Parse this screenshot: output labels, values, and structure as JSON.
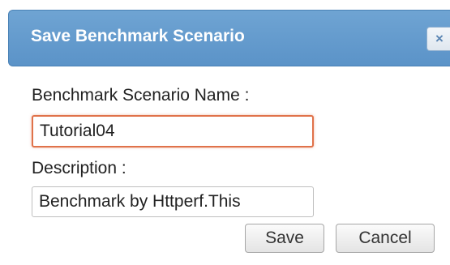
{
  "dialog": {
    "title": "Save Benchmark Scenario",
    "close_icon": "×"
  },
  "form": {
    "name_label": "Benchmark Scenario Name :",
    "name_value": "Tutorial04",
    "description_label": "Description :",
    "description_value": "Benchmark by Httperf.This"
  },
  "buttons": {
    "save_label": "Save",
    "cancel_label": "Cancel"
  },
  "colors": {
    "title_bar": "#5b93c8",
    "focus_border": "#e0724a"
  }
}
